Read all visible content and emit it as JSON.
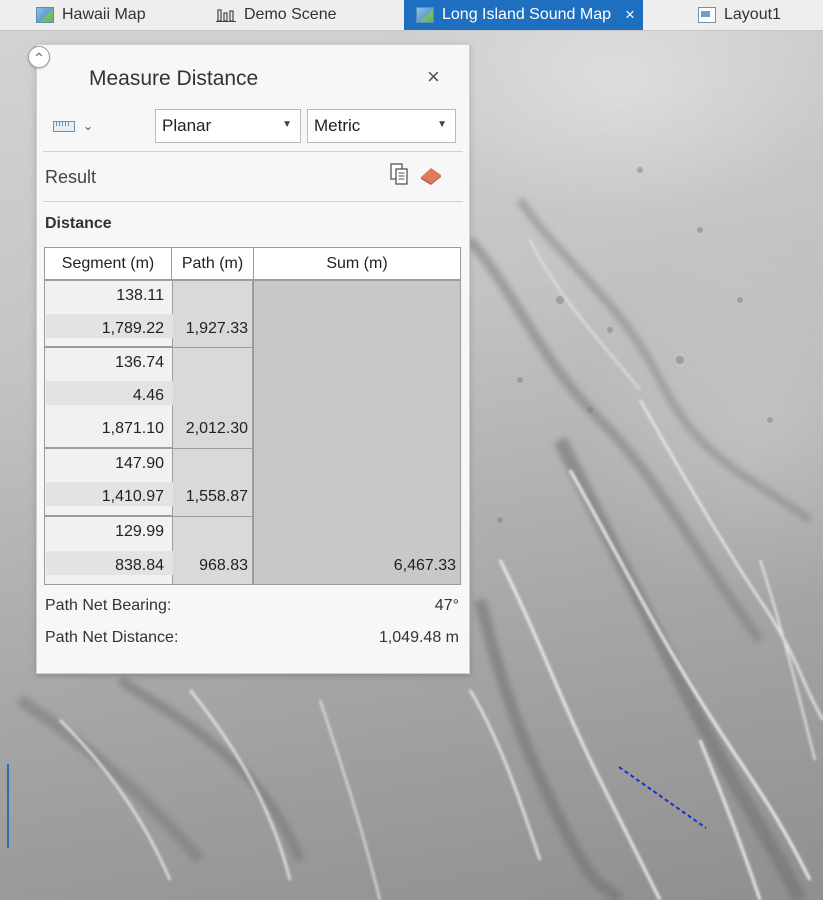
{
  "tabs": [
    {
      "label": "Hawaii Map",
      "icon": "map-tab-icon",
      "active": false
    },
    {
      "label": "Demo Scene",
      "icon": "scene-tab-icon",
      "active": false
    },
    {
      "label": "Long Island Sound Map",
      "icon": "map-tab-icon",
      "active": true,
      "close": "×"
    },
    {
      "label": "Layout1",
      "icon": "layout-tab-icon",
      "active": false
    }
  ],
  "panel": {
    "title": "Measure Distance",
    "close": "×",
    "collapse": "^",
    "mode_select": "Planar",
    "units_select": "Metric",
    "result_label": "Result",
    "distance_label": "Distance",
    "columns": [
      "Segment (m)",
      "Path (m)",
      "Sum (m)"
    ],
    "groups": [
      {
        "segments": [
          "138.11",
          "1,789.22"
        ],
        "path": "1,927.33"
      },
      {
        "segments": [
          "136.74",
          "4.46",
          "1,871.10"
        ],
        "path": "2,012.30"
      },
      {
        "segments": [
          "147.90",
          "1,410.97"
        ],
        "path": "1,558.87"
      },
      {
        "segments": [
          "129.99",
          "838.84"
        ],
        "path": "968.83"
      }
    ],
    "sum": "6,467.33",
    "bearing_label": "Path Net Bearing:",
    "bearing_value": "47°",
    "net_distance_label": "Path Net Distance:",
    "net_distance_value": "1,049.48 m"
  },
  "colors": {
    "active_tab": "#1f6fc0",
    "measure_line": "#1a2fd6"
  }
}
